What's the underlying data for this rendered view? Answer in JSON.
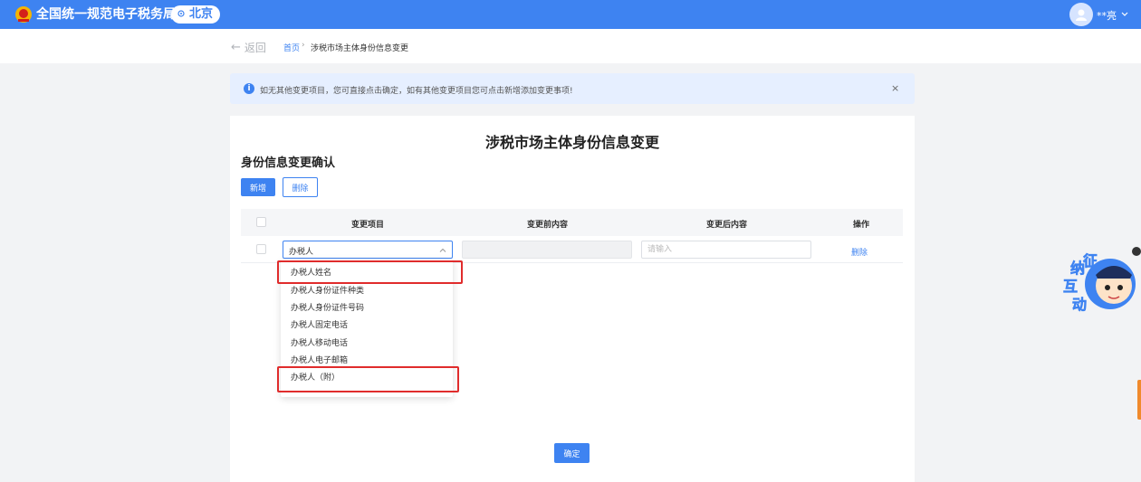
{
  "header": {
    "app_title": "全国统一规范电子税务局",
    "region": "北京",
    "user_name": "**亮"
  },
  "breadcrumb": {
    "back_label": "返回",
    "home": "首页",
    "separator": "›",
    "current": "涉税市场主体身份信息变更"
  },
  "notice": {
    "text": "如无其他变更项目，您可直接点击确定，如有其他变更项目您可点击新增添加变更事项!",
    "close": "×"
  },
  "main": {
    "page_title": "涉税市场主体身份信息变更",
    "section_title": "身份信息变更确认",
    "add_label": "新增",
    "delete_label": "删除",
    "table": {
      "headers": [
        "变更项目",
        "变更前内容",
        "变更后内容",
        "操作"
      ],
      "row": {
        "selected_value": "办税人",
        "after_placeholder": "请输入",
        "action": "删除"
      }
    },
    "dropdown_options": [
      "办税人姓名",
      "办税人身份证件种类",
      "办税人身份证件号码",
      "办税人固定电话",
      "办税人移动电话",
      "办税人电子邮箱",
      "办税人（附）"
    ],
    "confirm_label": "确定"
  },
  "widget": {
    "chars": [
      "征",
      "纳",
      "互",
      "动"
    ]
  },
  "colors": {
    "primary": "#3e83f1",
    "highlight": "#e02c2c",
    "notice_bg": "#e6efff"
  }
}
